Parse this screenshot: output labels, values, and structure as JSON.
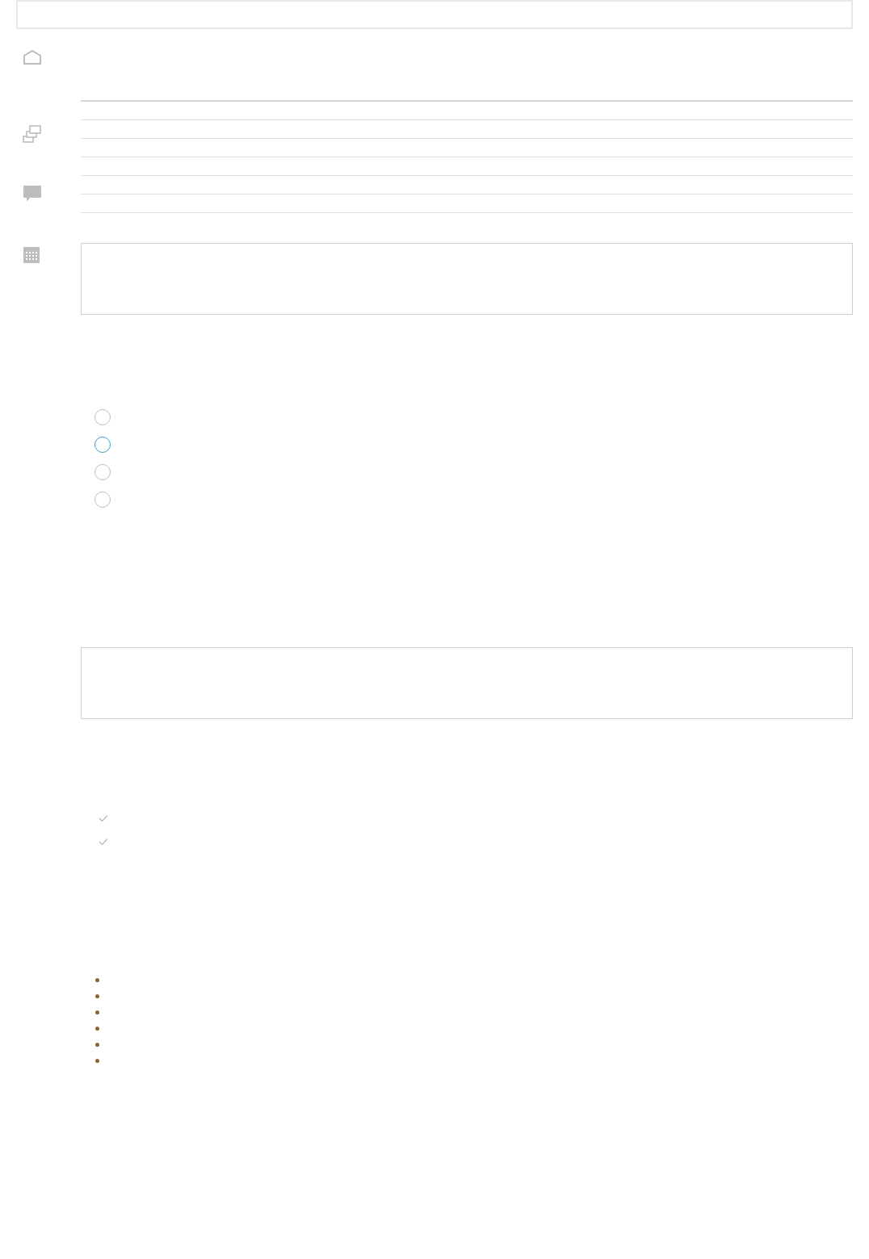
{
  "top_field": {
    "kind": "input"
  },
  "nav_icons": [
    {
      "kind": "home"
    },
    {
      "kind": "windows"
    },
    {
      "kind": "comment"
    },
    {
      "kind": "calendar"
    }
  ],
  "table": {
    "rows": [
      {
        "kind": "row"
      },
      {
        "kind": "row"
      },
      {
        "kind": "row"
      },
      {
        "kind": "row"
      },
      {
        "kind": "row"
      },
      {
        "kind": "row"
      }
    ]
  },
  "text_areas": [
    {
      "kind": "textarea"
    },
    {
      "kind": "textarea"
    }
  ],
  "radios": [
    {
      "color": "#bdbdbd"
    },
    {
      "color": "#3a9cc8"
    },
    {
      "color": "#bdbdbd"
    },
    {
      "color": "#bdbdbd"
    }
  ],
  "checks": [
    {
      "checked": true
    },
    {
      "checked": true
    }
  ],
  "bullets": [
    {
      "kind": "dot"
    },
    {
      "kind": "dot"
    },
    {
      "kind": "dot"
    },
    {
      "kind": "dot"
    },
    {
      "kind": "dot"
    },
    {
      "kind": "dot"
    }
  ]
}
